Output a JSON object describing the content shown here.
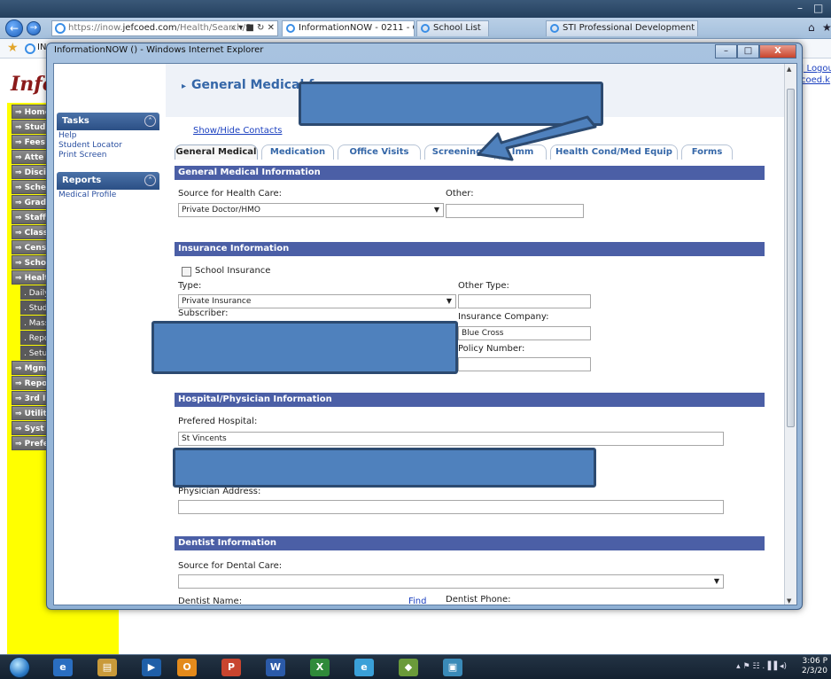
{
  "browser": {
    "address_prefix": "https://inow.",
    "address_domain": "jefcoed.com",
    "address_suffix": "/Health/Search/S",
    "address_tools": "⌕ ▾ ■ ↻ ✕",
    "tabs": [
      {
        "label": "InformationNOW - 0211 - C... ✕"
      },
      {
        "label": "School List"
      },
      {
        "label": "STI Professional Development ..."
      }
    ],
    "fav_text": "IN"
  },
  "background_page": {
    "logo": "Infor",
    "menu_items": [
      "Home",
      "Stud",
      "Fees",
      "Atte",
      "Disci",
      "Sche",
      "Grade",
      "Staff",
      "Class",
      "Cens",
      "Scho",
      "Healt"
    ],
    "sub_items": [
      ". Daily",
      ". Stud",
      ". Mass",
      ". Repo",
      ". Setu"
    ],
    "menu_items_after": [
      "Mgm",
      "Repo",
      "3rd I",
      "Utilit",
      "Syst",
      "Prefe"
    ],
    "right_links": [
      "| Logou",
      "coed.k"
    ]
  },
  "modal": {
    "title": "InformationNOW () - Windows Internet Explorer",
    "ctrl_min": "–",
    "ctrl_max": "□",
    "ctrl_close": "X"
  },
  "task_pane": {
    "tasks_header": "Tasks",
    "tasks_links": [
      "Help",
      "Student Locator",
      "Print Screen"
    ],
    "reports_header": "Reports",
    "reports_links": [
      "Medical Profile"
    ],
    "toggle": "˄"
  },
  "page": {
    "title": "General Medical for",
    "title_marker": "▸",
    "show_hide": "Show/Hide Contacts",
    "tabs": [
      "General Medical",
      "Medication",
      "Office Visits",
      "Screenings",
      "Imm",
      "Health Cond/Med Equip",
      "Forms"
    ],
    "active_tab": "General Medical"
  },
  "general_medical": {
    "header": "General Medical Information",
    "source_label": "Source for Health Care:",
    "source_value": "Private Doctor/HMO",
    "other_label": "Other:",
    "other_value": ""
  },
  "insurance": {
    "header": "Insurance Information",
    "school_insurance_label": "School Insurance",
    "school_insurance_checked": false,
    "type_label": "Type:",
    "type_value": "Private Insurance",
    "other_type_label": "Other Type:",
    "other_type_value": "",
    "subscriber_label": "Subscriber:",
    "company_label": "Insurance Company:",
    "company_value": "Blue Cross",
    "policy_label": "Policy Number:",
    "policy_value": ""
  },
  "hospital": {
    "header": "Hospital/Physician Information",
    "preferred_label": "Prefered Hospital:",
    "preferred_value": "St Vincents",
    "address_label": "Physician Address:",
    "address_value": ""
  },
  "dentist": {
    "header": "Dentist Information",
    "source_label": "Source for Dental Care:",
    "source_value": "",
    "name_label": "Dentist Name:",
    "find_label": "Find",
    "phone_label": "Dentist Phone:"
  },
  "dropdown_glyph": "▼",
  "taskbar": {
    "time": "3:06 P",
    "date": "2/3/20",
    "tray_icons": "▴  ⚑  ☷  .▐▐  ◂)"
  },
  "colors": {
    "section_bar": "#4b5fa6",
    "redaction": "#4f81bd",
    "link": "#1a3fbf"
  }
}
